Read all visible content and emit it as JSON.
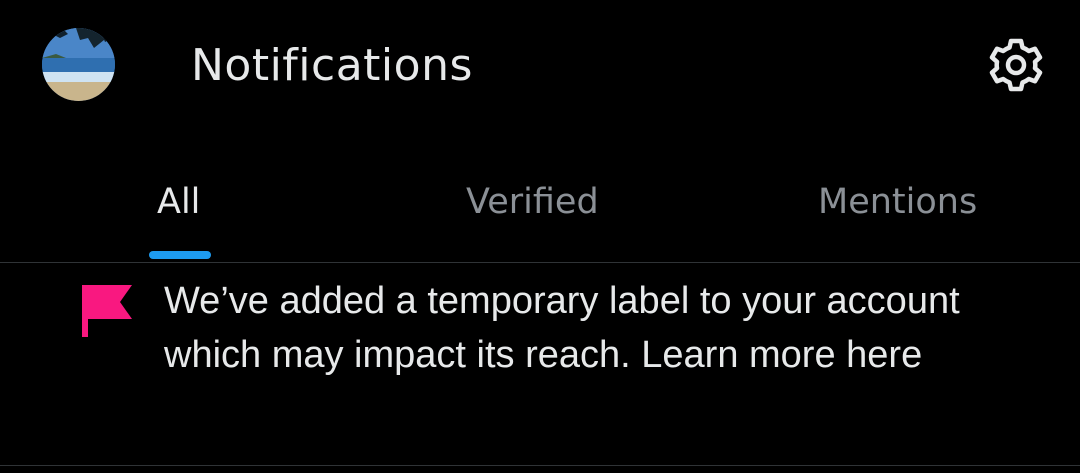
{
  "header": {
    "title": "Notifications",
    "avatar_icon": "profile-avatar-beach",
    "settings_icon": "gear-icon"
  },
  "tabs": [
    {
      "label": "All",
      "active": true
    },
    {
      "label": "Verified",
      "active": false
    },
    {
      "label": "Mentions",
      "active": false
    }
  ],
  "notice": {
    "icon": "flag-icon",
    "text": "We’ve added a temporary label to your account which may impact its reach. Learn more here"
  },
  "colors": {
    "background": "#000000",
    "text_primary": "#e7e9ea",
    "text_secondary": "#8b9096",
    "accent": "#1d9bf0",
    "flag": "#f91880",
    "divider": "#2f3336"
  }
}
